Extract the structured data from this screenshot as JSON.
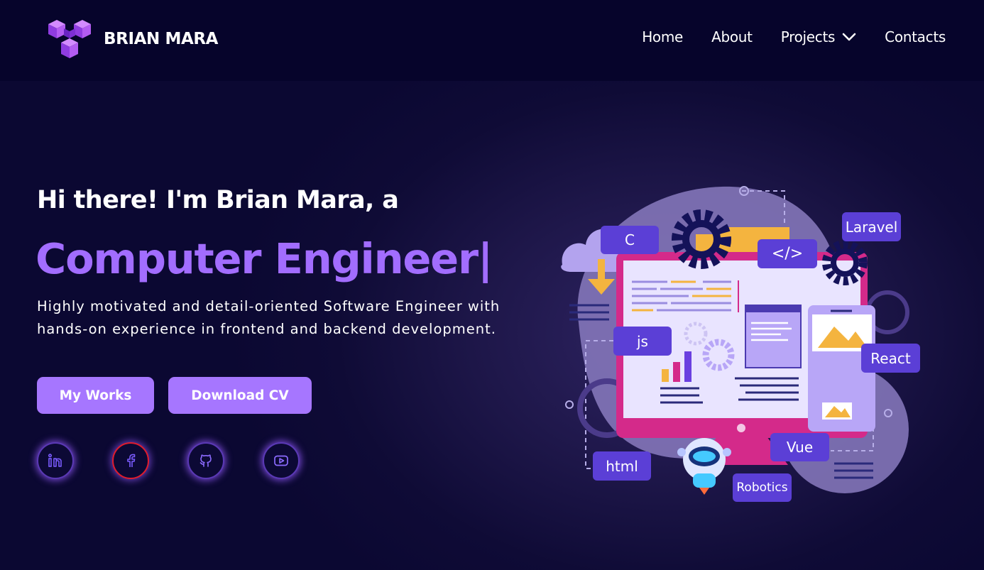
{
  "brand": {
    "name": "BRIAN MARA"
  },
  "nav": {
    "items": [
      "Home",
      "About",
      "Projects",
      "Contacts"
    ]
  },
  "hero": {
    "intro": "Hi there! I'm Brian Mara, a",
    "role": "Computer Engineer",
    "cursor": "|",
    "description": "Highly motivated and detail-oriented Software Engineer with hands-on experience in frontend and backend development.",
    "buttons": {
      "works": "My Works",
      "cv": "Download CV"
    }
  },
  "socials": [
    {
      "icon": "linkedin-icon"
    },
    {
      "icon": "facebook-icon"
    },
    {
      "icon": "github-icon"
    },
    {
      "icon": "youtube-icon"
    }
  ],
  "illustration": {
    "tags": {
      "c": "C",
      "code": "</>",
      "laravel": "Laravel",
      "js": "js",
      "react": "React",
      "vue": "Vue",
      "html": "html",
      "robotics": "Robotics"
    }
  },
  "colors": {
    "accent": "#a676ff",
    "background": "#0a0731",
    "header": "#06042b",
    "tag": "#5b3fd6",
    "monitor": "#d42a8a"
  }
}
